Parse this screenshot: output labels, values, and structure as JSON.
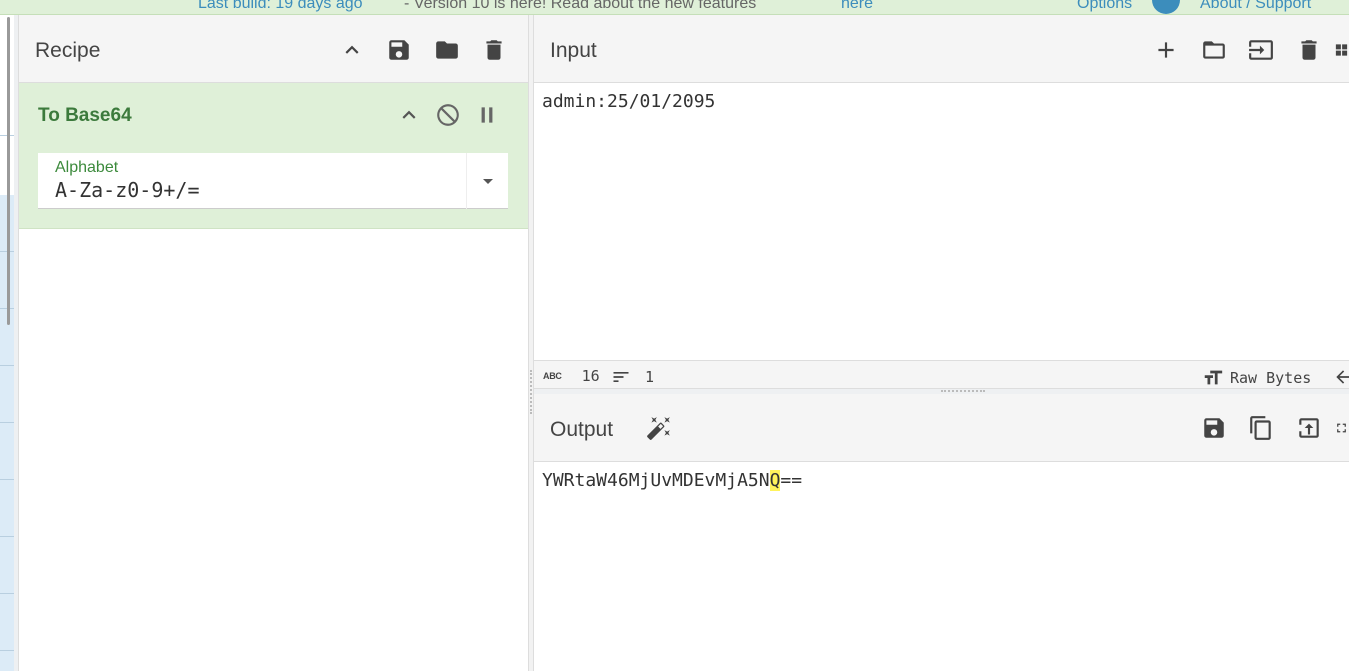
{
  "banner": {
    "last_build": "Last build: 19 days ago",
    "version_note": "- Version 10 is here! Read about the new features",
    "here_link": "here",
    "options": "Options",
    "about": "About / Support"
  },
  "recipe": {
    "title": "Recipe",
    "operation": {
      "name": "To Base64",
      "alphabet_label": "Alphabet",
      "alphabet_value": "A-Za-z0-9+/="
    }
  },
  "input": {
    "title": "Input",
    "text": "admin:25/01/2095",
    "status": {
      "length": "16",
      "lines": "1",
      "encoding": "Raw Bytes"
    }
  },
  "output": {
    "title": "Output",
    "text_before": "YWRtaW46MjUvMDEvMjA5N",
    "text_highlight": "Q",
    "text_after": "=="
  },
  "icons": {
    "accent": "#3c8dbc",
    "recipe_head": "#f5f5f5",
    "operation_bg": "#dff0d8",
    "operation_title": "#3c7a3c"
  }
}
